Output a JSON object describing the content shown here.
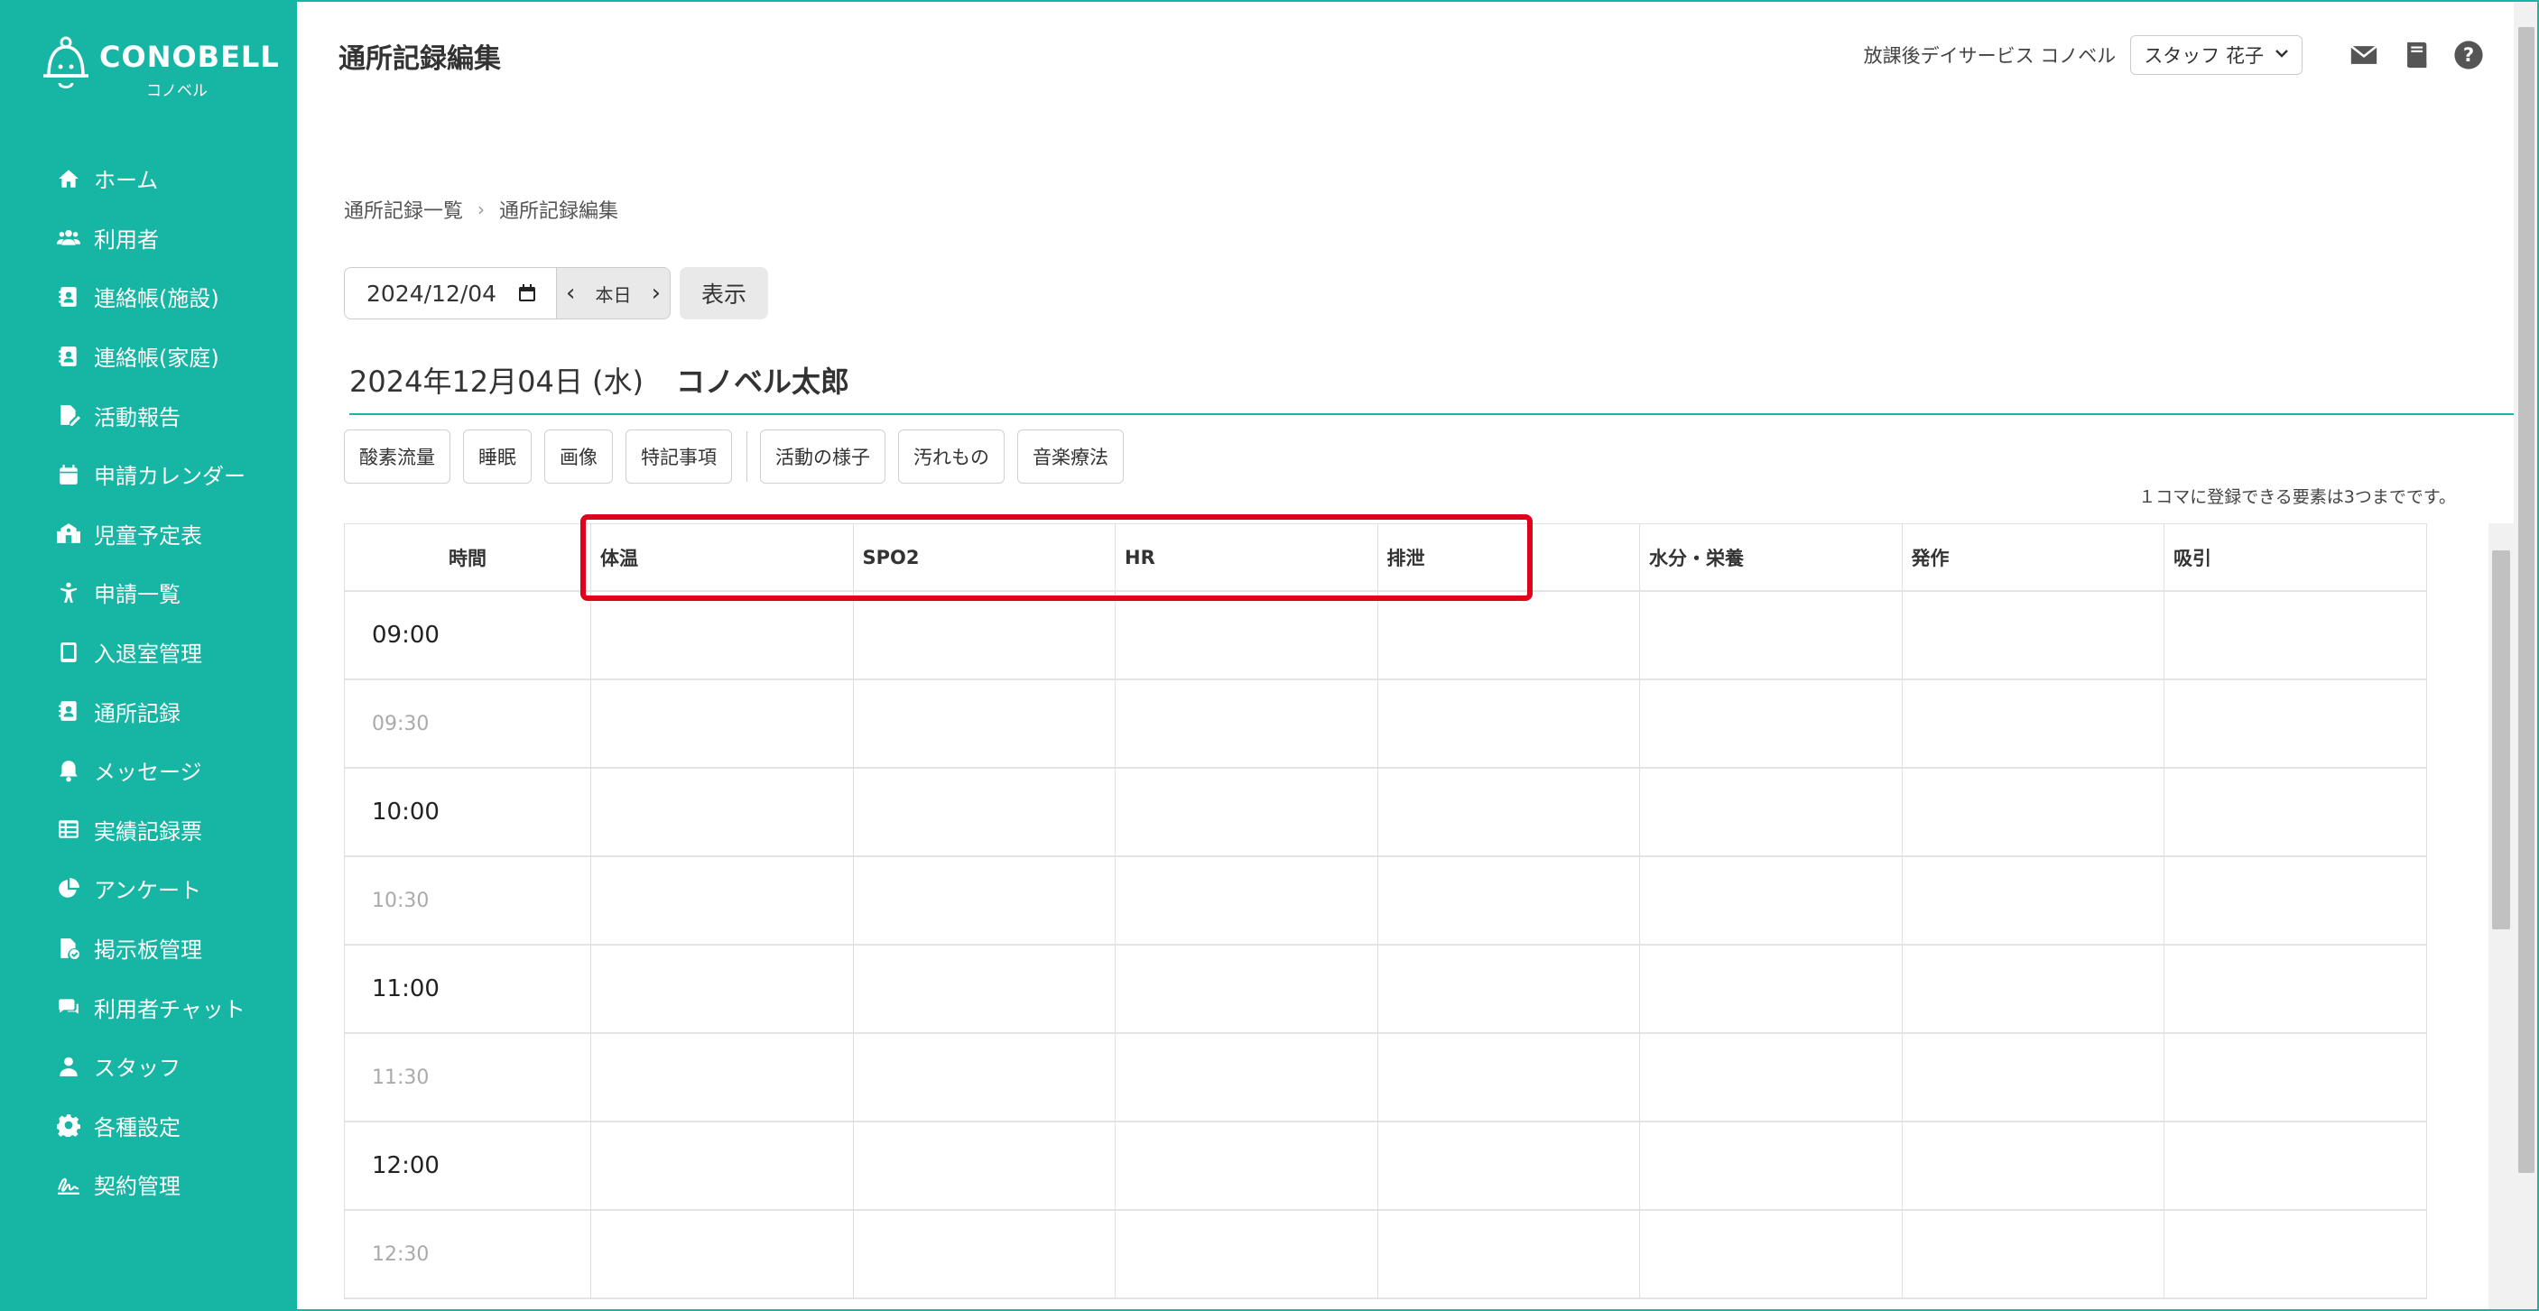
{
  "brand": {
    "name": "CONOBELL",
    "sub": "コノベル"
  },
  "sidebar": {
    "items": [
      {
        "label": "ホーム",
        "icon": "home-icon"
      },
      {
        "label": "利用者",
        "icon": "users-icon"
      },
      {
        "label": "連絡帳(施設)",
        "icon": "contact-book-icon"
      },
      {
        "label": "連絡帳(家庭)",
        "icon": "contact-book-icon"
      },
      {
        "label": "活動報告",
        "icon": "file-edit-icon"
      },
      {
        "label": "申請カレンダー",
        "icon": "calendar-icon"
      },
      {
        "label": "児童予定表",
        "icon": "school-icon"
      },
      {
        "label": "申請一覧",
        "icon": "child-icon"
      },
      {
        "label": "入退室管理",
        "icon": "tablet-icon"
      },
      {
        "label": "通所記録",
        "icon": "contact-book-icon"
      },
      {
        "label": "メッセージ",
        "icon": "bell-icon"
      },
      {
        "label": "実績記録票",
        "icon": "table-icon"
      },
      {
        "label": "アンケート",
        "icon": "pie-chart-icon"
      },
      {
        "label": "掲示板管理",
        "icon": "file-check-icon"
      },
      {
        "label": "利用者チャット",
        "icon": "chat-icon"
      },
      {
        "label": "スタッフ",
        "icon": "user-icon"
      },
      {
        "label": "各種設定",
        "icon": "gear-icon"
      },
      {
        "label": "契約管理",
        "icon": "signature-icon"
      }
    ]
  },
  "header": {
    "title": "通所記録編集",
    "facility": "放課後デイサービス コノベル",
    "staff": "スタッフ 花子"
  },
  "breadcrumb": {
    "items": [
      "通所記録一覧",
      "通所記録編集"
    ]
  },
  "date_picker": {
    "value": "2024/12/04",
    "today_label": "本日",
    "show_label": "表示"
  },
  "record": {
    "date": "2024年12月04日 (水)",
    "name": "コノベル太郎"
  },
  "tabs": {
    "group1": [
      "酸素流量",
      "睡眠",
      "画像",
      "特記事項"
    ],
    "group2": [
      "活動の様子",
      "汚れもの",
      "音楽療法"
    ]
  },
  "limit_note": "１コマに登録できる要素は3つまでです。",
  "table": {
    "time_header": "時間",
    "columns": [
      "体温",
      "SPO2",
      "HR",
      "排泄",
      "水分・栄養",
      "発作",
      "吸引"
    ],
    "rows": [
      "09:00",
      "09:30",
      "10:00",
      "10:30",
      "11:00",
      "11:30",
      "12:00",
      "12:30"
    ]
  },
  "colors": {
    "accent": "#17b5a3",
    "highlight": "#e0001b"
  }
}
